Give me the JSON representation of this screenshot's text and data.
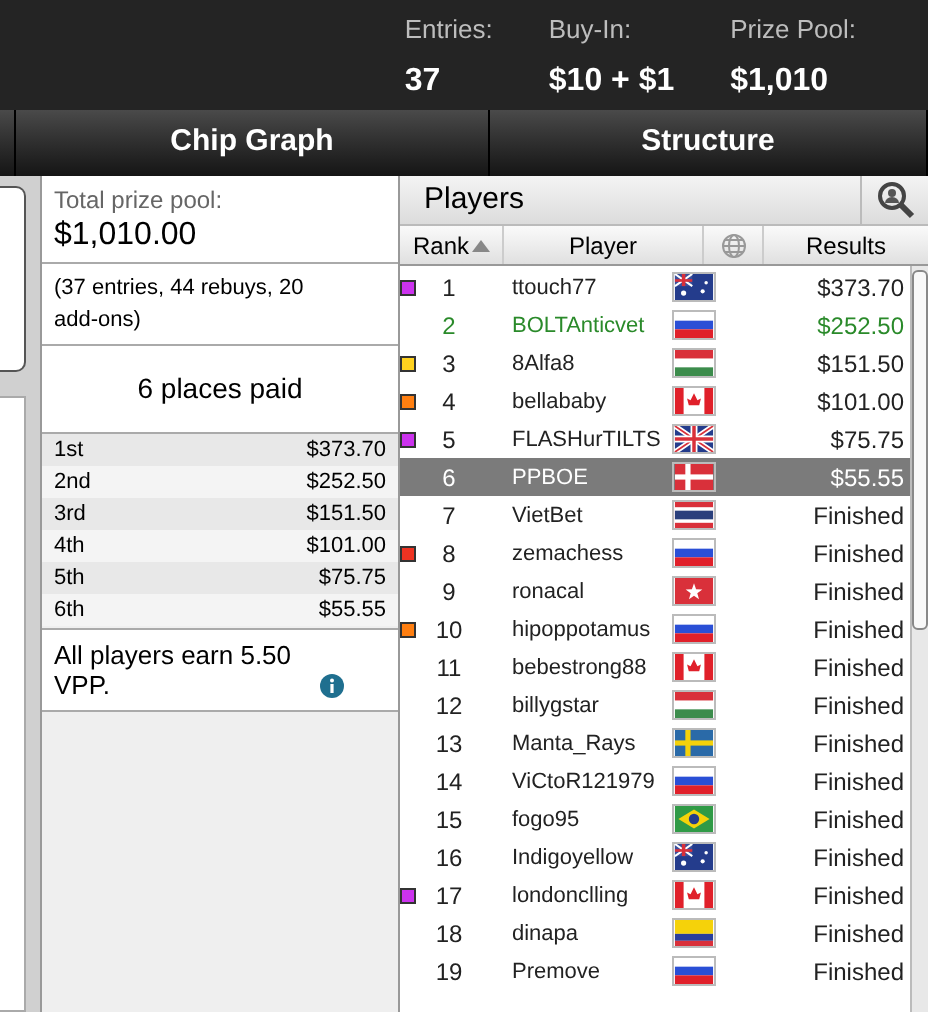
{
  "header": {
    "stats": [
      {
        "label": "Entries:",
        "value": "37"
      },
      {
        "label": "Buy-In:",
        "value": "$10 + $1"
      },
      {
        "label": "Prize Pool:",
        "value": "$1,010"
      }
    ]
  },
  "tabs": [
    "Chip Graph",
    "Structure"
  ],
  "prizes": {
    "total_label": "Total prize pool:",
    "total": "$1,010.00",
    "breakdown": "(37 entries, 44 rebuys, 20 add-ons)",
    "places_paid": "6 places paid",
    "payouts": [
      {
        "place": "1st",
        "amount": "$373.70"
      },
      {
        "place": "2nd",
        "amount": "$252.50"
      },
      {
        "place": "3rd",
        "amount": "$151.50"
      },
      {
        "place": "4th",
        "amount": "$101.00"
      },
      {
        "place": "5th",
        "amount": "$75.75"
      },
      {
        "place": "6th",
        "amount": "$55.55"
      }
    ],
    "vpp": "All players earn 5.50 VPP."
  },
  "players": {
    "title": "Players",
    "columns": [
      "Rank",
      "Player",
      "Results"
    ],
    "rows": [
      {
        "rank": "1",
        "name": "ttouch77",
        "flag": {
          "kind": "au"
        },
        "result": "$373.70",
        "color": "#cc33ee",
        "highlighted": false,
        "selected": false
      },
      {
        "rank": "2",
        "name": "BOLTAnticvet",
        "flag": {
          "kind": "ru"
        },
        "result": "$252.50",
        "highlighted": true,
        "selected": false
      },
      {
        "rank": "3",
        "name": "8Alfa8",
        "flag": {
          "kind": "hu"
        },
        "result": "$151.50",
        "color": "#ffd21f",
        "highlighted": false,
        "selected": false
      },
      {
        "rank": "4",
        "name": "bellababy",
        "flag": {
          "kind": "ca"
        },
        "result": "$101.00",
        "color": "#ff7f11",
        "highlighted": false,
        "selected": false
      },
      {
        "rank": "5",
        "name": "FLASHurTILTS",
        "flag": {
          "kind": "gb"
        },
        "result": "$75.75",
        "color": "#cc33ee",
        "highlighted": false,
        "selected": false
      },
      {
        "rank": "6",
        "name": "PPBOE",
        "flag": {
          "kind": "dk"
        },
        "result": "$55.55",
        "highlighted": false,
        "selected": true
      },
      {
        "rank": "7",
        "name": "VietBet",
        "flag": {
          "kind": "th"
        },
        "result": "Finished",
        "highlighted": false,
        "selected": false
      },
      {
        "rank": "8",
        "name": "zemachess",
        "flag": {
          "kind": "ru"
        },
        "result": "Finished",
        "color": "#ee3322",
        "highlighted": false,
        "selected": false
      },
      {
        "rank": "9",
        "name": "ronacal",
        "flag": {
          "kind": "hk"
        },
        "result": "Finished",
        "highlighted": false,
        "selected": false
      },
      {
        "rank": "10",
        "name": "hipoppotamus",
        "flag": {
          "kind": "ru"
        },
        "result": "Finished",
        "color": "#ff7f11",
        "highlighted": false,
        "selected": false
      },
      {
        "rank": "11",
        "name": "bebestrong88",
        "flag": {
          "kind": "ca"
        },
        "result": "Finished",
        "highlighted": false,
        "selected": false
      },
      {
        "rank": "12",
        "name": "billygstar",
        "flag": {
          "kind": "hu"
        },
        "result": "Finished",
        "highlighted": false,
        "selected": false
      },
      {
        "rank": "13",
        "name": "Manta_Rays",
        "flag": {
          "kind": "se"
        },
        "result": "Finished",
        "highlighted": false,
        "selected": false
      },
      {
        "rank": "14",
        "name": "ViCtoR121979",
        "flag": {
          "kind": "ru"
        },
        "result": "Finished",
        "highlighted": false,
        "selected": false
      },
      {
        "rank": "15",
        "name": "fogo95",
        "flag": {
          "kind": "br"
        },
        "result": "Finished",
        "highlighted": false,
        "selected": false
      },
      {
        "rank": "16",
        "name": "Indigoyellow",
        "flag": {
          "kind": "au"
        },
        "result": "Finished",
        "highlighted": false,
        "selected": false
      },
      {
        "rank": "17",
        "name": "londonclling",
        "flag": {
          "kind": "ca"
        },
        "result": "Finished",
        "color": "#cc33ee",
        "highlighted": false,
        "selected": false
      },
      {
        "rank": "18",
        "name": "dinapa",
        "flag": {
          "kind": "co"
        },
        "result": "Finished",
        "highlighted": false,
        "selected": false
      },
      {
        "rank": "19",
        "name": "Premove",
        "flag": {
          "kind": "ru"
        },
        "result": "Finished",
        "highlighted": false,
        "selected": false
      }
    ]
  }
}
